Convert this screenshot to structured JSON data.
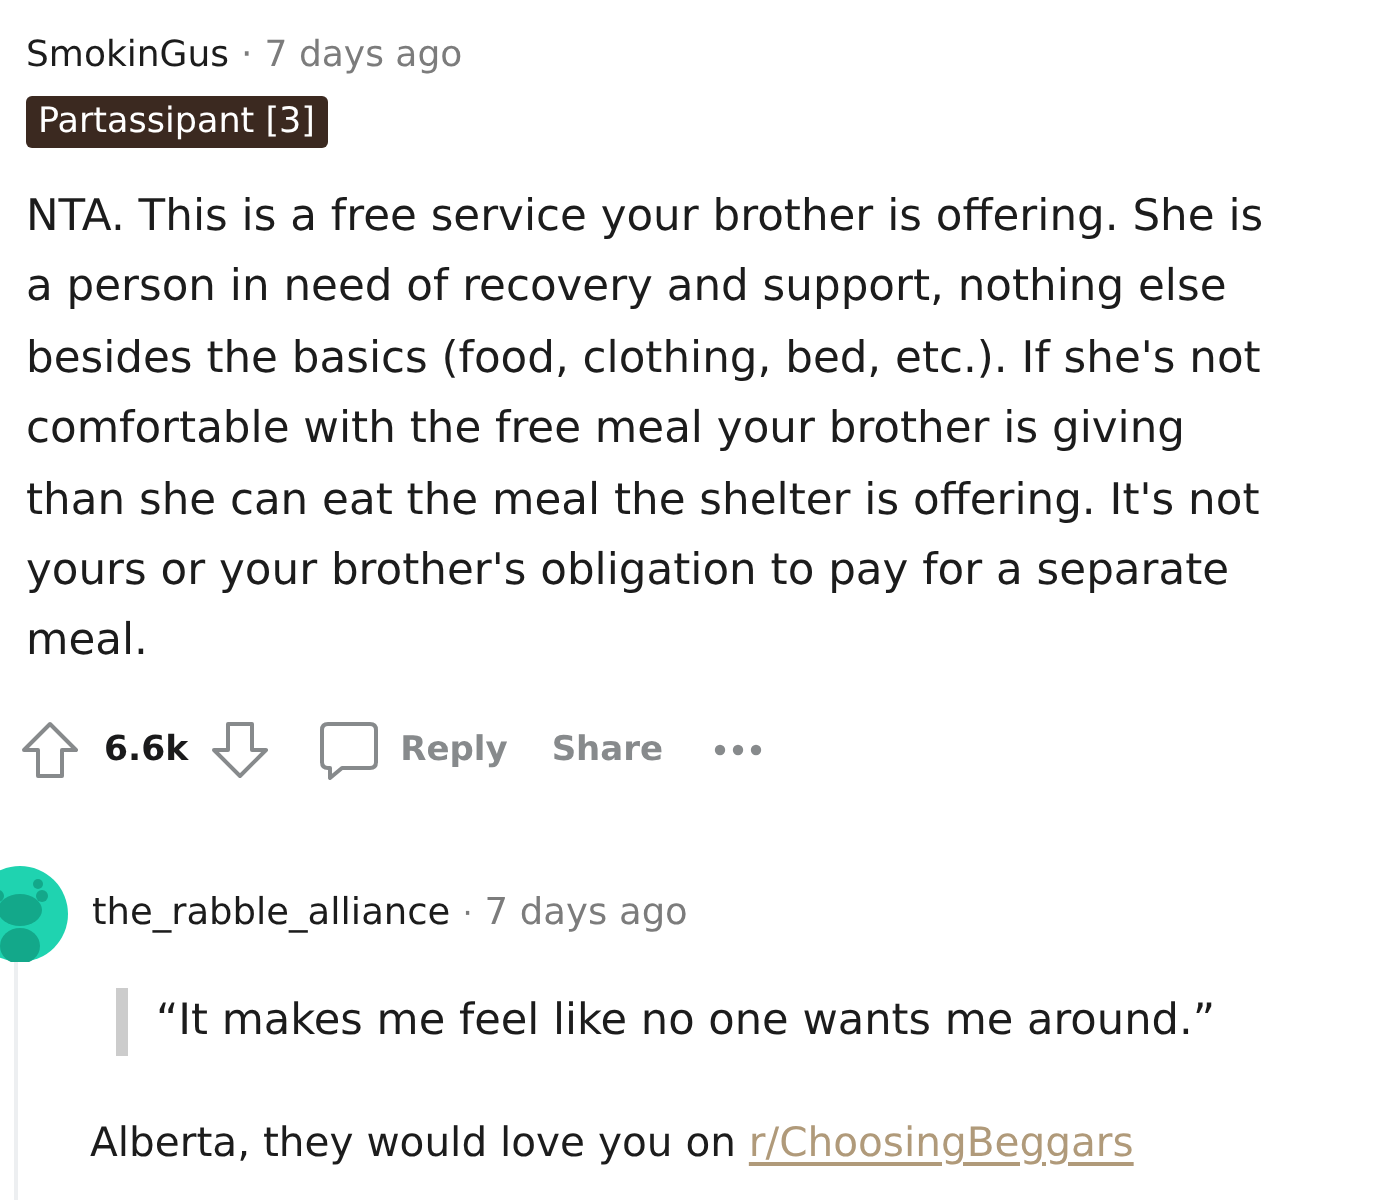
{
  "comments": [
    {
      "author": "SmokinGus",
      "separator": "·",
      "time": "7 days ago",
      "flair": "Partassipant [3]",
      "body": "NTA. This is a free service your brother is offering. She is a person in need of recovery and support, nothing else besides the basics (food, clothing, bed, etc.). If she's not comfortable with the free meal your brother is giving than she can eat the meal the shelter is offering. It's not yours or your brother's obligation to pay for a separate meal.",
      "votes": "6.6k",
      "actions": [
        {
          "kind": "reply",
          "label": "Reply"
        },
        {
          "kind": "share",
          "label": "Share"
        },
        {
          "kind": "more"
        }
      ]
    },
    {
      "author": "the_rabble_alliance",
      "separator": "·",
      "time": "7 days ago",
      "quote": "“It makes me feel like no one wants me around.”",
      "text": "Alberta, they would love you on",
      "link": "r/ChoosingBeggars"
    }
  ]
}
